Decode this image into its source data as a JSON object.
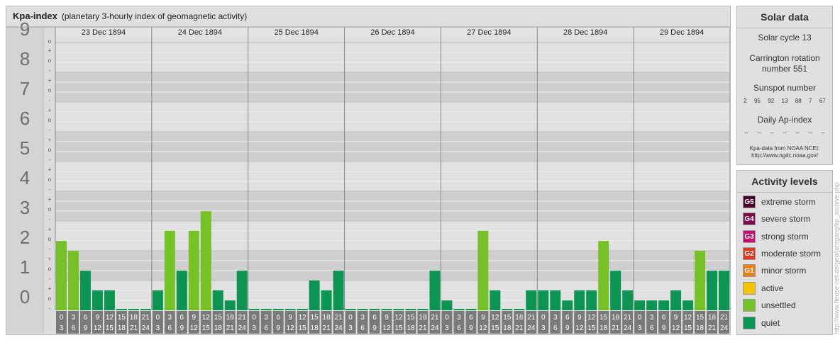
{
  "title": {
    "main": "Kpa-index",
    "sub": "(planetary 3-hourly index of geomagnetic activity)"
  },
  "chart_data": {
    "type": "bar",
    "title": "Kpa-index",
    "subtitle": "(planetary 3-hourly index of geomagnetic activity)",
    "ylim": [
      0,
      9
    ],
    "y_ticks": [
      "0",
      "1",
      "2",
      "3",
      "4",
      "5",
      "6",
      "7",
      "8",
      "9"
    ],
    "minor_marks": [
      "-",
      "o",
      "+"
    ],
    "days": [
      "23 Dec 1894",
      "24 Dec 1894",
      "25 Dec 1894",
      "26 Dec 1894",
      "27 Dec 1894",
      "28 Dec 1894",
      "29 Dec 1894"
    ],
    "interval_start": [
      "0",
      "3",
      "6",
      "9",
      "12",
      "15",
      "18",
      "21"
    ],
    "interval_end": [
      "3",
      "6",
      "9",
      "12",
      "15",
      "18",
      "21",
      "24"
    ],
    "values": [
      [
        2.33,
        2.0,
        1.33,
        0.67,
        0.67,
        0.0,
        0.0,
        0.0
      ],
      [
        0.67,
        2.67,
        1.33,
        2.67,
        3.33,
        0.67,
        0.33,
        1.33
      ],
      [
        0.0,
        0.0,
        0.0,
        0.0,
        0.0,
        1.0,
        0.67,
        1.33
      ],
      [
        0.0,
        0.0,
        0.0,
        0.0,
        0.0,
        0.0,
        0.0,
        1.33
      ],
      [
        0.33,
        0.0,
        0.0,
        2.67,
        0.67,
        0.0,
        0.0,
        0.67
      ],
      [
        0.67,
        0.67,
        0.33,
        0.67,
        0.67,
        2.33,
        1.33,
        0.67
      ],
      [
        0.33,
        0.33,
        0.33,
        0.67,
        0.33,
        2.0,
        1.33,
        1.33
      ]
    ],
    "colors": {
      "quiet": "#0c9452",
      "unsettled": "#76c126",
      "active": "#f5c400"
    }
  },
  "solar": {
    "title": "Solar data",
    "cycle": "Solar cycle 13",
    "carrington_line1": "Carrington rotation",
    "carrington_line2": "number 551",
    "sunspot_label": "Sunspot number",
    "sunspots": [
      "2",
      "95",
      "92",
      "13",
      "88",
      "7",
      "67"
    ],
    "ap_label": "Daily Ap-index",
    "ap_values": [
      "--",
      "--",
      "--",
      "--",
      "--",
      "--",
      "--"
    ],
    "source_line1": "Kpa-data from NOAA NCEI:",
    "source_line2": "http://www.ngdc.noaa.gov/"
  },
  "levels": {
    "title": "Activity levels",
    "items": [
      {
        "code": "G5",
        "label": "extreme storm",
        "color": "#4a0026"
      },
      {
        "code": "G4",
        "label": "severe storm",
        "color": "#7d0c4b"
      },
      {
        "code": "G3",
        "label": "strong storm",
        "color": "#c40f6e"
      },
      {
        "code": "G2",
        "label": "moderate storm",
        "color": "#dd3a1c"
      },
      {
        "code": "G1",
        "label": "minor storm",
        "color": "#f07d12"
      },
      {
        "code": "",
        "label": "active",
        "color": "#f5c400"
      },
      {
        "code": "",
        "label": "unsettled",
        "color": "#76c126"
      },
      {
        "code": "",
        "label": "quiet",
        "color": "#0c9452"
      }
    ]
  },
  "credit": "http://www.fleuse-net.de/geo/jahrgang/kp_archive.php"
}
